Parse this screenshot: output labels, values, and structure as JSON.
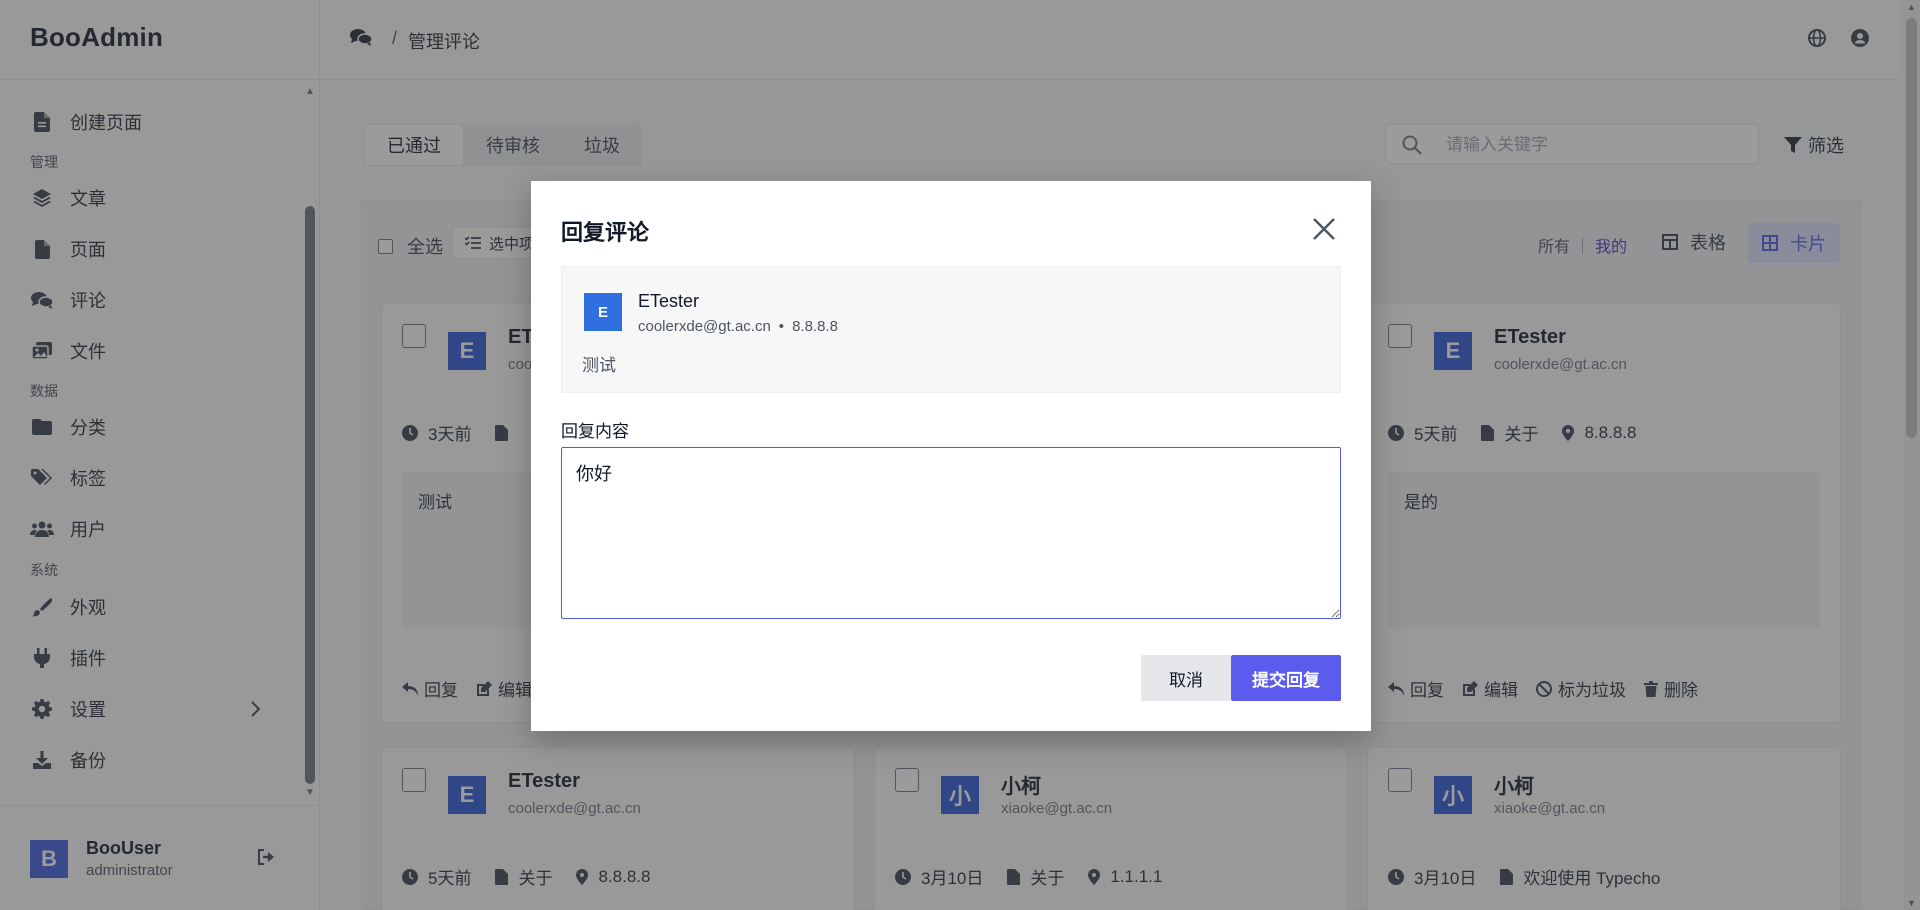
{
  "app": {
    "brand": "BooAdmin"
  },
  "sidebar": {
    "items": [
      {
        "label": "创建页面",
        "icon": "file-plus-icon"
      },
      {
        "group": "管理"
      },
      {
        "label": "文章",
        "icon": "layers-icon"
      },
      {
        "label": "页面",
        "icon": "file-icon"
      },
      {
        "label": "评论",
        "icon": "comments-icon"
      },
      {
        "label": "文件",
        "icon": "images-icon"
      },
      {
        "group": "数据"
      },
      {
        "label": "分类",
        "icon": "folder-icon"
      },
      {
        "label": "标签",
        "icon": "tags-icon"
      },
      {
        "label": "用户",
        "icon": "users-icon"
      },
      {
        "group": "系统"
      },
      {
        "label": "外观",
        "icon": "brush-icon"
      },
      {
        "label": "插件",
        "icon": "plug-icon"
      },
      {
        "label": "设置",
        "icon": "gear-icon"
      },
      {
        "label": "备份",
        "icon": "download-icon"
      }
    ],
    "user": {
      "initial": "B",
      "name": "BooUser",
      "role": "administrator"
    }
  },
  "topbar": {
    "breadcrumb_sep": "/",
    "breadcrumb": "管理评论"
  },
  "main": {
    "tabs": [
      "已通过",
      "待审核",
      "垃圾"
    ],
    "search_placeholder": "请输入关键字",
    "filter_label": "筛选",
    "toolbar": {
      "select_all": "全选",
      "selected_items": "选中项",
      "scope_all": "所有",
      "scope_mine": "我的",
      "view_table": "表格",
      "view_card": "卡片"
    },
    "cards": [
      {
        "initial": "E",
        "name": "ET",
        "email": "cool",
        "time": "3天前",
        "page": "",
        "content": "测试",
        "actions": [
          "回复",
          "编辑"
        ]
      },
      {
        "initial": "E",
        "name": "ETester",
        "email": "coolerxde@gt.ac.cn",
        "time": "5天前",
        "page": "关于",
        "ip": "8.8.8.8",
        "content": "是的",
        "actions": [
          "回复",
          "编辑",
          "标为垃圾",
          "删除"
        ]
      },
      {
        "initial": "E",
        "name": "ETester",
        "email": "coolerxde@gt.ac.cn",
        "time": "5天前",
        "page": "关于",
        "ip": "8.8.8.8"
      },
      {
        "initial": "小",
        "name": "小柯",
        "email": "xiaoke@gt.ac.cn",
        "time": "3月10日",
        "page": "关于",
        "ip": "1.1.1.1"
      },
      {
        "initial": "小",
        "name": "小柯",
        "email": "xiaoke@gt.ac.cn",
        "time": "3月10日",
        "page": "欢迎使用 Typecho"
      }
    ]
  },
  "dialog": {
    "title": "回复评论",
    "comment": {
      "initial": "E",
      "author": "ETester",
      "email": "coolerxde@gt.ac.cn",
      "dot": "•",
      "ip": "8.8.8.8",
      "text": "测试"
    },
    "field_label": "回复内容",
    "reply_value": "你好",
    "cancel_label": "取消",
    "submit_label": "提交回复"
  },
  "colors": {
    "accent": "#5b5bee",
    "avatar": "#2954d6",
    "overlay": "rgba(55,55,55,0.5)"
  }
}
